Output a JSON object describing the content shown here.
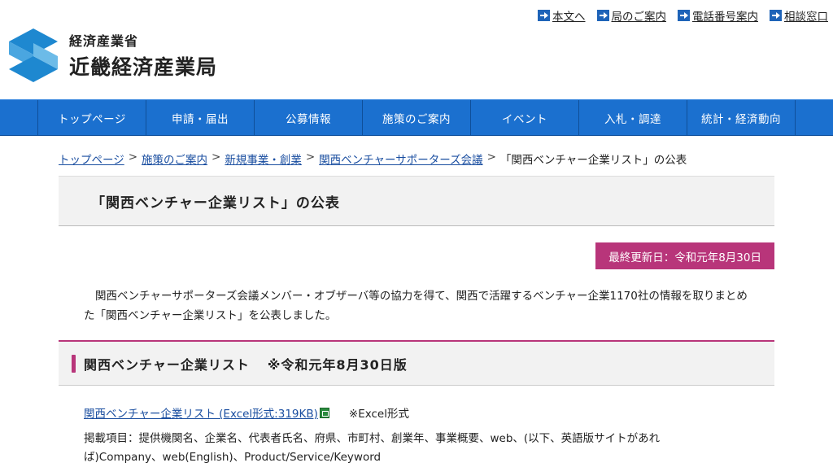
{
  "utility_links": [
    {
      "label": "本文へ",
      "icon": "arrow-right-icon"
    },
    {
      "label": "局のご案内",
      "icon": "arrow-right-icon"
    },
    {
      "label": "電話番号案内",
      "icon": "arrow-right-icon"
    },
    {
      "label": "相談窓口",
      "icon": "arrow-right-icon"
    }
  ],
  "logo": {
    "ministry": "経済産業省",
    "bureau": "近畿経済産業局"
  },
  "nav": [
    "トップページ",
    "申請・届出",
    "公募情報",
    "施策のご案内",
    "イベント",
    "入札・調達",
    "統計・経済動向"
  ],
  "breadcrumb": {
    "links": [
      "トップページ",
      "施策のご案内",
      "新規事業・創業",
      "関西ベンチャーサポーターズ会議"
    ],
    "separator": ">",
    "current": "「関西ベンチャー企業リスト」の公表"
  },
  "page_title": "「関西ベンチャー企業リスト」の公表",
  "last_updated": "最終更新日：令和元年8月30日",
  "intro": "関西ベンチャーサポーターズ会議メンバー・オブザーバ等の協力を得て、関西で活躍するベンチャー企業1170社の情報を取りまとめた「関西ベンチャー企業リスト」を公表しました。",
  "section": {
    "title": "関西ベンチャー企業リスト",
    "note": "※令和元年8月30日版"
  },
  "file": {
    "link": "関西ベンチャー企業リスト (Excel形式:319KB)",
    "format": "※Excel形式",
    "icon": "excel-file-icon"
  },
  "items_text": "掲載項目：提供機関名、企業名、代表者氏名、府県、市町村、創業年、事業概要、web、(以下、英語版サイトがあれば)Company、web(English)、Product/Service/Keyword",
  "colors": {
    "nav": "#1b70cf",
    "accent": "#b8357a",
    "logo": "#1e88d0"
  }
}
